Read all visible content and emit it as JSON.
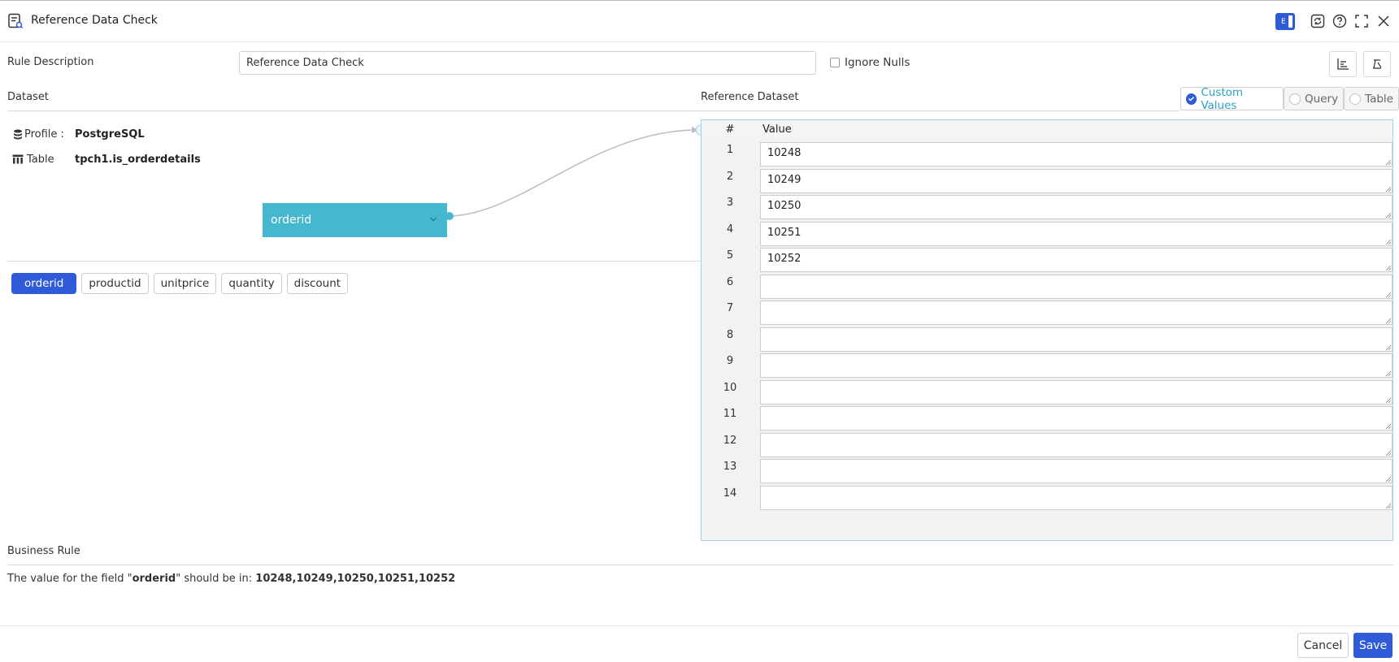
{
  "header": {
    "title": "Reference Data Check",
    "badge_letter": "E"
  },
  "form": {
    "rule_description_label": "Rule Description",
    "rule_description_value": "Reference Data Check",
    "ignore_nulls_label": "Ignore Nulls",
    "ignore_nulls_checked": false
  },
  "dataset": {
    "label": "Dataset",
    "profile_label": "Profile :",
    "profile_value": "PostgreSQL",
    "table_label": "Table",
    "table_value": "tpch1.is_orderdetails",
    "node_field": "orderid"
  },
  "reference": {
    "label": "Reference Dataset",
    "tabs": [
      {
        "label": "Custom Values",
        "selected": true
      },
      {
        "label": "Query",
        "selected": false
      },
      {
        "label": "Table",
        "selected": false
      }
    ],
    "grid_headers": {
      "num": "#",
      "value": "Value"
    },
    "rows": [
      {
        "num": "1",
        "value": "10248"
      },
      {
        "num": "2",
        "value": "10249"
      },
      {
        "num": "3",
        "value": "10250"
      },
      {
        "num": "4",
        "value": "10251"
      },
      {
        "num": "5",
        "value": "10252"
      },
      {
        "num": "6",
        "value": ""
      },
      {
        "num": "7",
        "value": ""
      },
      {
        "num": "8",
        "value": ""
      },
      {
        "num": "9",
        "value": ""
      },
      {
        "num": "10",
        "value": ""
      },
      {
        "num": "11",
        "value": ""
      },
      {
        "num": "12",
        "value": ""
      },
      {
        "num": "13",
        "value": ""
      },
      {
        "num": "14",
        "value": ""
      }
    ]
  },
  "fields": [
    {
      "label": "orderid",
      "active": true
    },
    {
      "label": "productid",
      "active": false
    },
    {
      "label": "unitprice",
      "active": false
    },
    {
      "label": "quantity",
      "active": false
    },
    {
      "label": "discount",
      "active": false
    }
  ],
  "business_rule": {
    "label": "Business Rule",
    "text_prefix": "The value for the field \"",
    "field": "orderid",
    "text_middle": "\" should be in: ",
    "values": "10248,10249,10250,10251,10252"
  },
  "footer": {
    "cancel_label": "Cancel",
    "save_label": "Save"
  },
  "colors": {
    "accent": "#2f5bd8",
    "node": "#45b8d0",
    "tab_active_text": "#2aa0c8"
  }
}
